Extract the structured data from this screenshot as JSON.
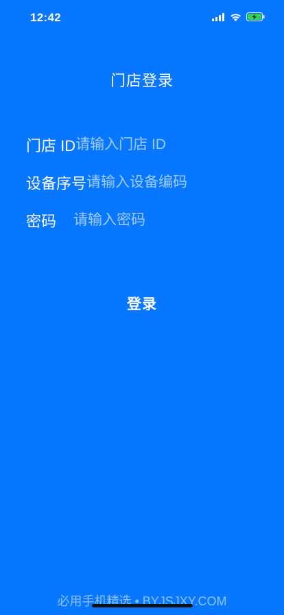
{
  "status_bar": {
    "time": "12:42",
    "icons": [
      "cellular-signal-icon",
      "wifi-icon",
      "battery-charging-icon"
    ]
  },
  "page": {
    "title": "门店登录"
  },
  "form": {
    "store_id": {
      "label": "门店 ID",
      "value": "",
      "placeholder": "请输入门店 ID"
    },
    "device_serial": {
      "label": "设备序号",
      "value": "",
      "placeholder": "请输入设备编码"
    },
    "password": {
      "label": "密码",
      "value": "",
      "placeholder": "请输入密码"
    }
  },
  "actions": {
    "login_label": "登录"
  },
  "watermark": {
    "text": "必用手机精选 • BYJSJXY.COM"
  },
  "colors": {
    "background": "#0777FF",
    "text": "#FFFFFF",
    "battery_fill": "#33D058"
  }
}
